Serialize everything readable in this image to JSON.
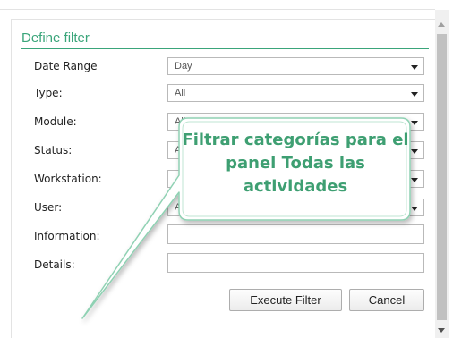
{
  "section_title": "Define filter",
  "fields": [
    {
      "label": "Date Range",
      "value": "Day"
    },
    {
      "label": "Type:",
      "value": "All"
    },
    {
      "label": "Module:",
      "value": "All"
    },
    {
      "label": "Status:",
      "value": "All"
    },
    {
      "label": "Workstation:",
      "value": ""
    },
    {
      "label": "User:",
      "value": "All"
    },
    {
      "label": "Information:",
      "value": ""
    },
    {
      "label": "Details:",
      "value": ""
    }
  ],
  "buttons": {
    "execute": "Execute Filter",
    "cancel": "Cancel"
  },
  "callout": {
    "line1": "Filtrar categorías para el",
    "line2": "panel Todas las",
    "line3": "actividades"
  },
  "colors": {
    "accent": "#3aa57a",
    "callout_text": "#3e9f72",
    "callout_border": "#8fd1b3"
  }
}
